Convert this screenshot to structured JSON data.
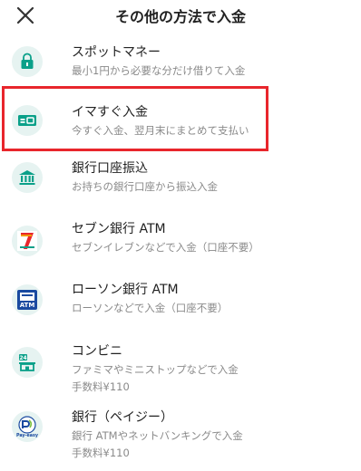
{
  "header": {
    "title": "その他の方法で入金",
    "close_icon": "close-icon"
  },
  "colors": {
    "accent": "#0aa089",
    "icon_bg": "#e6f3f1",
    "highlight": "#e8262c"
  },
  "items": [
    {
      "name": "スポットマネー",
      "desc": "最小1円から必要な分だけ借りて入金",
      "icon": "lock-icon"
    },
    {
      "name": "イマすぐ入金",
      "desc": "今すぐ入金、翌月末にまとめて支払い",
      "icon": "card-icon"
    },
    {
      "name": "銀行口座振込",
      "desc": "お持ちの銀行口座から振込入金",
      "icon": "bank-icon"
    },
    {
      "name": "セブン銀行 ATM",
      "desc": "セブンイレブンなどで入金（口座不要）",
      "icon": "seven-bank-logo"
    },
    {
      "name": "ローソン銀行 ATM",
      "desc": "ローソンなどで入金（口座不要）",
      "icon": "lawson-bank-logo",
      "logo_text": "ATM"
    },
    {
      "name": "コンビニ",
      "desc": "ファミマやミニストップなどで入金",
      "fee": "手数料¥110",
      "icon": "convenience-store-icon",
      "logo_text": "24"
    },
    {
      "name": "銀行（ペイジー）",
      "desc": "銀行 ATMやネットバンキングで入金",
      "fee": "手数料¥110",
      "icon": "pay-easy-logo",
      "logo_text": "Pay-easy"
    }
  ]
}
